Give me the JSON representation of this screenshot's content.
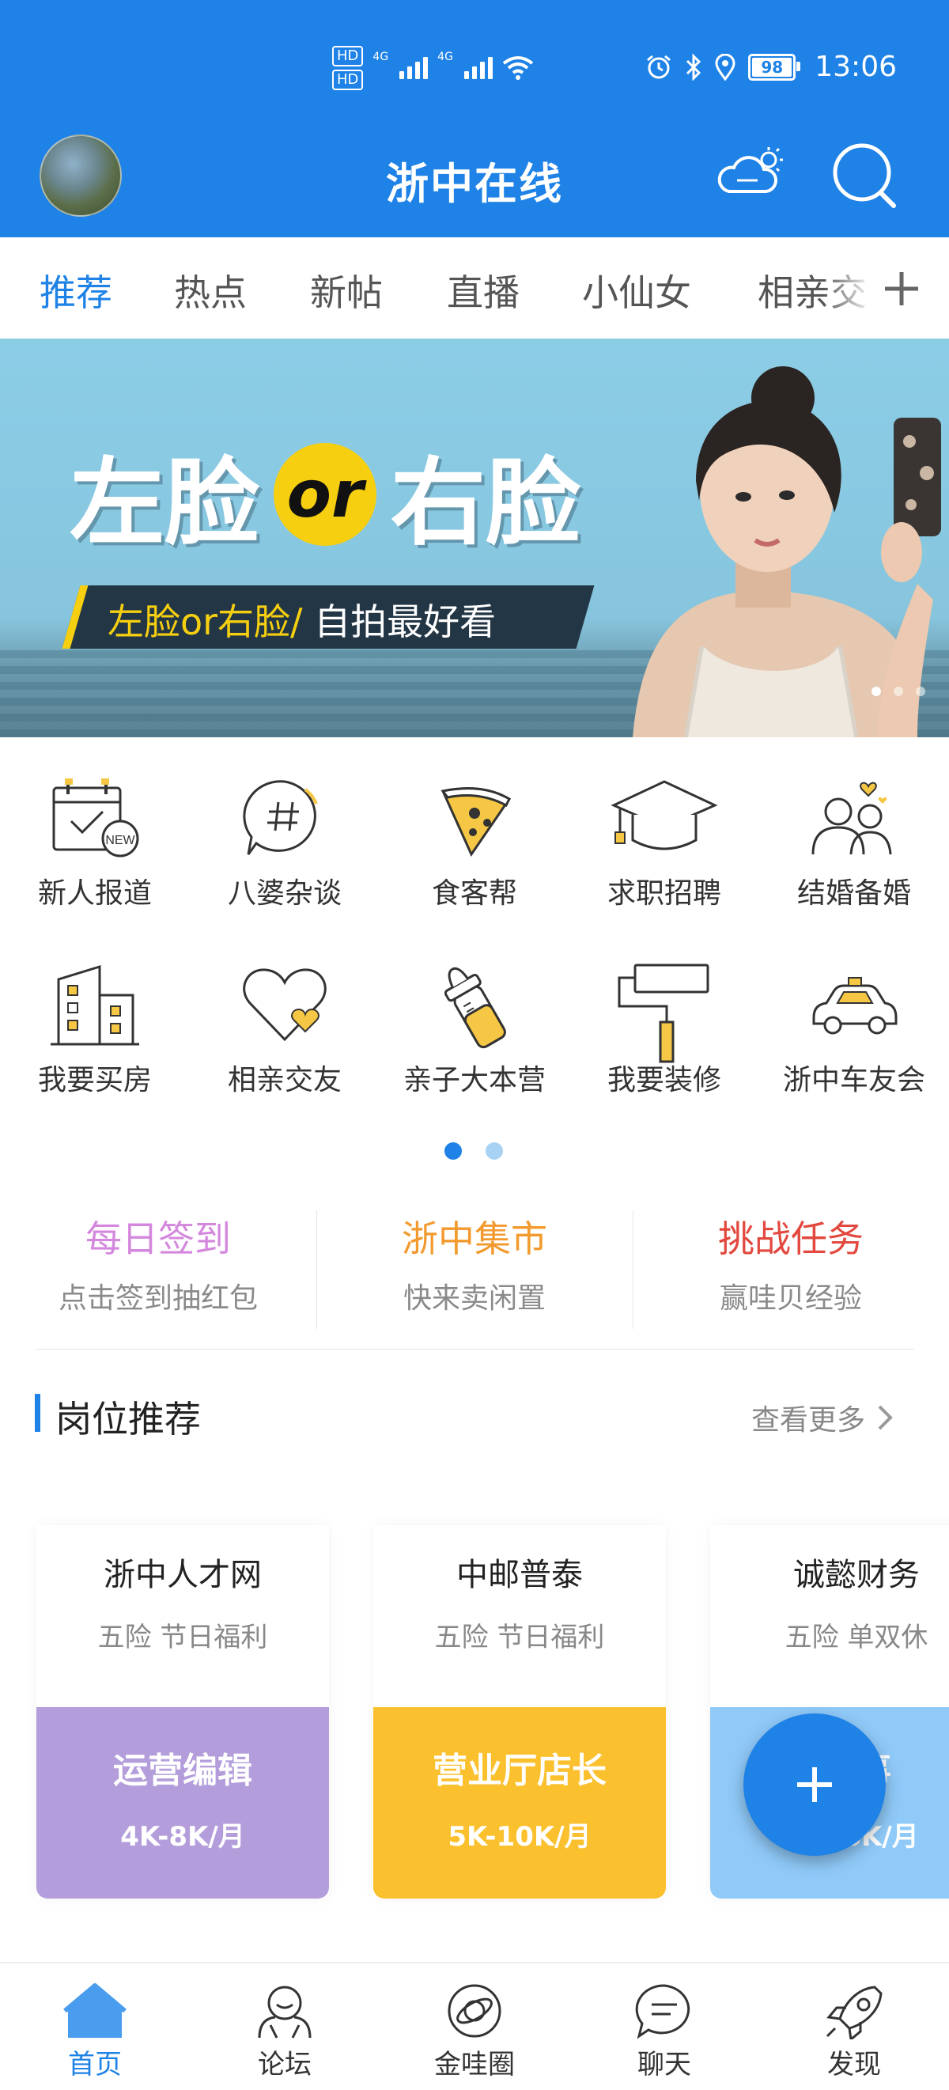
{
  "status_bar": {
    "hd1": "HD",
    "hd2": "HD",
    "net1": "4G",
    "net2": "4G",
    "battery": "98",
    "time": "13:06"
  },
  "header": {
    "title": "浙中在线",
    "icons": [
      "avatar",
      "weather-icon",
      "search-icon"
    ]
  },
  "tabs": {
    "items": [
      "推荐",
      "热点",
      "新帖",
      "直播",
      "小仙女",
      "相亲交"
    ],
    "active_index": 0
  },
  "banner": {
    "title_left": "左脸",
    "title_or": "or",
    "title_right": "右脸",
    "sub_highlight": "左脸or右脸/",
    "sub_rest": " 自拍最好看"
  },
  "grid": {
    "items": [
      {
        "label": "新人报道",
        "icon": "calendar-new-icon"
      },
      {
        "label": "八婆杂谈",
        "icon": "hash-bubble-icon"
      },
      {
        "label": "食客帮",
        "icon": "pizza-icon"
      },
      {
        "label": "求职招聘",
        "icon": "graduation-cap-icon"
      },
      {
        "label": "结婚备婚",
        "icon": "couple-icon"
      },
      {
        "label": "我要买房",
        "icon": "buildings-icon"
      },
      {
        "label": "相亲交友",
        "icon": "heart-icon"
      },
      {
        "label": "亲子大本营",
        "icon": "baby-bottle-icon"
      },
      {
        "label": "我要装修",
        "icon": "paint-roller-icon"
      },
      {
        "label": "浙中车友会",
        "icon": "taxi-icon"
      }
    ],
    "page_count": 2,
    "current_page": 0
  },
  "quick_actions": [
    {
      "title": "每日签到",
      "subtitle": "点击签到抽红包",
      "color": "#D488DD"
    },
    {
      "title": "浙中集市",
      "subtitle": "快来卖闲置",
      "color": "#F29A2E"
    },
    {
      "title": "挑战任务",
      "subtitle": "赢哇贝经验",
      "color": "#E2483E"
    }
  ],
  "jobs_section": {
    "title": "岗位推荐",
    "more": "查看更多"
  },
  "jobs": [
    {
      "company": "浙中人才网",
      "benefits": "五险 节日福利",
      "position": "运营编辑",
      "salary": "4K-8K/月",
      "color": "#B39DDB"
    },
    {
      "company": "中邮普泰",
      "benefits": "五险 节日福利",
      "position": "营业厅店长",
      "salary": "5K-10K/月",
      "color": "#FBC02D"
    },
    {
      "company": "诚懿财务",
      "benefits": "五险 单双休",
      "position": "人事",
      "salary": "4K-6K/月",
      "color": "#90CAF9"
    }
  ],
  "fab": {
    "icon": "plus-icon"
  },
  "bottom_nav": {
    "items": [
      {
        "label": "首页",
        "icon": "home-icon"
      },
      {
        "label": "论坛",
        "icon": "forum-icon"
      },
      {
        "label": "金哇圈",
        "icon": "planet-icon"
      },
      {
        "label": "聊天",
        "icon": "chat-icon"
      },
      {
        "label": "发现",
        "icon": "rocket-icon"
      }
    ],
    "active_index": 0
  },
  "colors": {
    "primary": "#1E82E6",
    "pager_inactive": "#A8D2F3"
  }
}
